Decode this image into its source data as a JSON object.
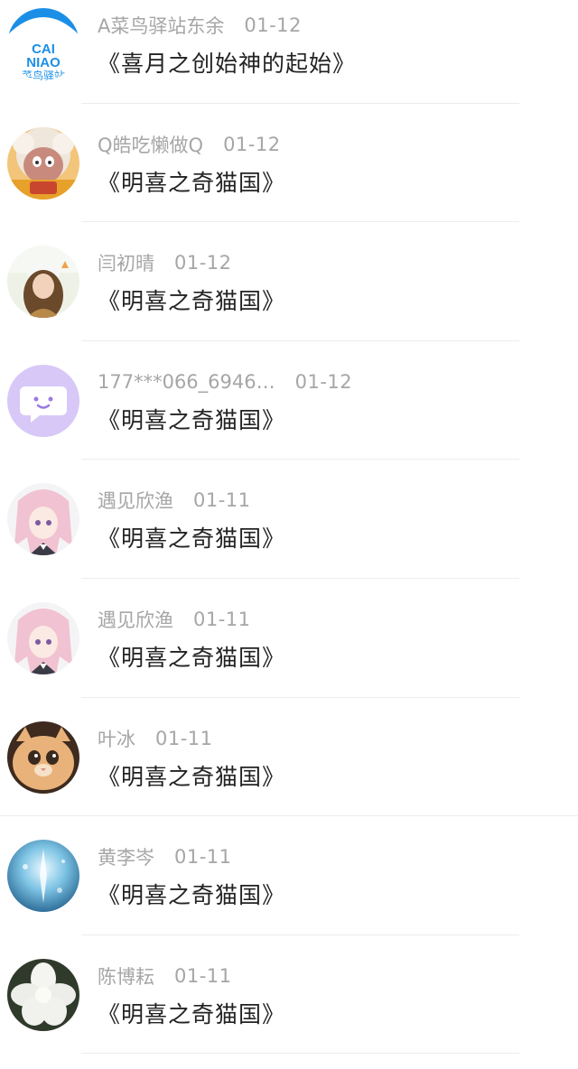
{
  "comments": [
    {
      "name": "A菜鸟驿站东余",
      "date": "01-12",
      "title": "《喜月之创始神的起始》",
      "avatar": "cainiao-logo",
      "logo_text": [
        "CAI",
        "NIAO",
        "菜鸟驿站"
      ],
      "accent": "#1b8fe6"
    },
    {
      "name": "Q皓吃懒做Q",
      "date": "01-12",
      "title": "《明喜之奇猫国》",
      "avatar": "cartoon-sheep-avatar"
    },
    {
      "name": "闫初晴",
      "date": "01-12",
      "title": "《明喜之奇猫国》",
      "avatar": "girl-photo-avatar"
    },
    {
      "name": "177***066_6946…",
      "date": "01-12",
      "title": "《明喜之奇猫国》",
      "avatar": "default-chat-avatar",
      "accent": "#c9b6f5"
    },
    {
      "name": "遇见欣渔",
      "date": "01-11",
      "title": "《明喜之奇猫国》",
      "avatar": "anime-girl-avatar"
    },
    {
      "name": "遇见欣渔",
      "date": "01-11",
      "title": "《明喜之奇猫国》",
      "avatar": "anime-girl-avatar"
    },
    {
      "name": "叶冰",
      "date": "01-11",
      "title": "《明喜之奇猫国》",
      "avatar": "cat-photo-avatar"
    },
    {
      "name": "黄李岑",
      "date": "01-11",
      "title": "《明喜之奇猫国》",
      "avatar": "fantasy-art-avatar"
    },
    {
      "name": "陈博耘",
      "date": "01-11",
      "title": "《明喜之奇猫国》",
      "avatar": "white-flower-avatar"
    }
  ]
}
